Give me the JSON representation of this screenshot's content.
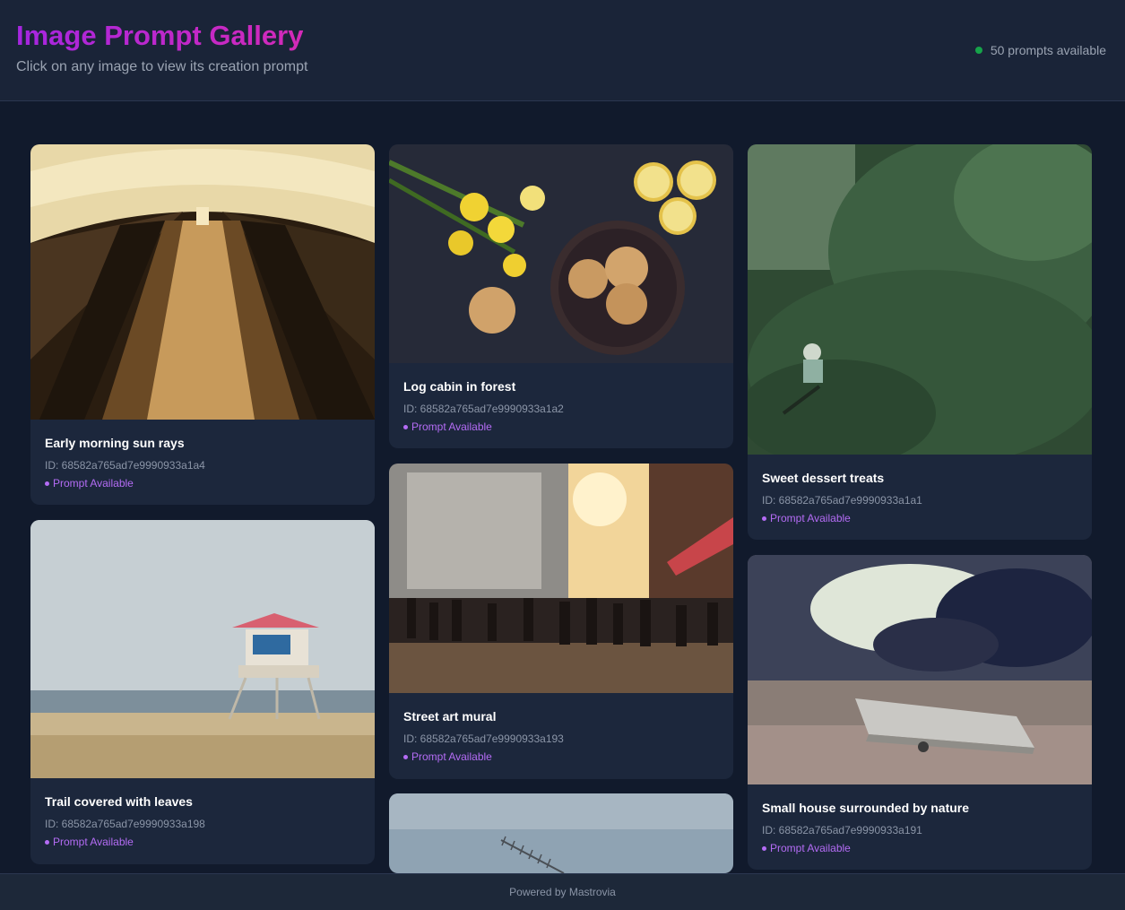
{
  "header": {
    "title": "Image Prompt Gallery",
    "subtitle": "Click on any image to view its creation prompt",
    "count_text": "50 prompts available"
  },
  "cards": [
    {
      "title": "Early morning sun rays",
      "id_text": "ID: 68582a765ad7e9990933a1a4",
      "badge": "Prompt Available"
    },
    {
      "title": "Log cabin in forest",
      "id_text": "ID: 68582a765ad7e9990933a1a2",
      "badge": "Prompt Available"
    },
    {
      "title": "Sweet dessert treats",
      "id_text": "ID: 68582a765ad7e9990933a1a1",
      "badge": "Prompt Available"
    },
    {
      "title": "Trail covered with leaves",
      "id_text": "ID: 68582a765ad7e9990933a198",
      "badge": "Prompt Available"
    },
    {
      "title": "Street art mural",
      "id_text": "ID: 68582a765ad7e9990933a193",
      "badge": "Prompt Available"
    },
    {
      "title": "Small house surrounded by nature",
      "id_text": "ID: 68582a765ad7e9990933a191",
      "badge": "Prompt Available"
    }
  ],
  "footer": {
    "text": "Powered by Mastrovia"
  },
  "colors": {
    "accent": "#b46cf5",
    "status": "#16a34a",
    "background": "#111a2c",
    "card": "#1c273c"
  }
}
